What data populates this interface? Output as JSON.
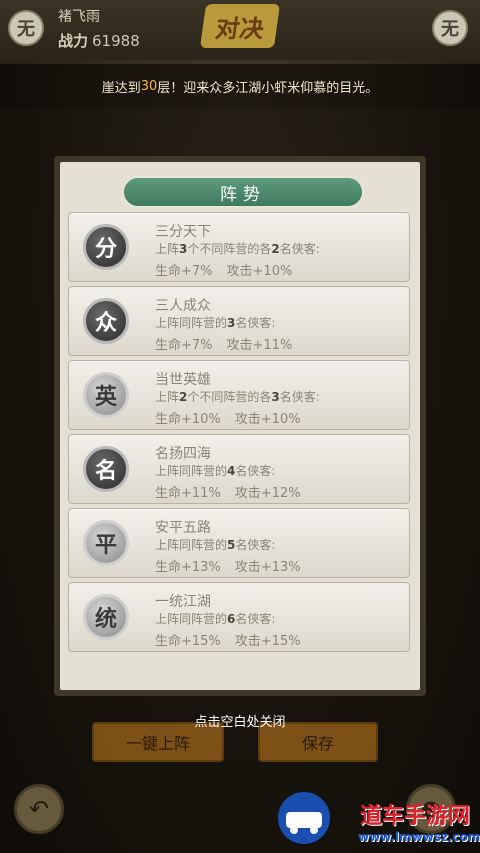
{
  "header": {
    "left_icon_char": "无",
    "right_icon_char": "无",
    "player_name": "褚飞雨",
    "power_label": "战力",
    "power_value": "61988",
    "vs_char": "对决"
  },
  "notice": {
    "prefix": "崖达到",
    "highlight": "30",
    "suffix": "层！迎来众多江湖小虾米仰慕的目光。"
  },
  "dialog": {
    "title": "阵势",
    "formations": [
      {
        "icon": "分",
        "name": "三分天下",
        "cond_pre": "上阵",
        "cond_num1": "3",
        "cond_mid": "个不同阵营的各",
        "cond_num2": "2",
        "cond_post": "名侠客:",
        "hp": "生命+7%",
        "atk": "攻击+10%",
        "style": "dark"
      },
      {
        "icon": "众",
        "name": "三人成众",
        "cond_pre": "上阵同阵营的",
        "cond_num1": "3",
        "cond_mid": "",
        "cond_num2": "",
        "cond_post": "名侠客:",
        "hp": "生命+7%",
        "atk": "攻击+11%",
        "style": "dark"
      },
      {
        "icon": "英",
        "name": "当世英雄",
        "cond_pre": "上阵",
        "cond_num1": "2",
        "cond_mid": "个不同阵营的各",
        "cond_num2": "3",
        "cond_post": "名侠客:",
        "hp": "生命+10%",
        "atk": "攻击+10%",
        "style": "light"
      },
      {
        "icon": "名",
        "name": "名扬四海",
        "cond_pre": "上阵同阵营的",
        "cond_num1": "4",
        "cond_mid": "",
        "cond_num2": "",
        "cond_post": "名侠客:",
        "hp": "生命+11%",
        "atk": "攻击+12%",
        "style": "dark"
      },
      {
        "icon": "平",
        "name": "安平五路",
        "cond_pre": "上阵同阵营的",
        "cond_num1": "5",
        "cond_mid": "",
        "cond_num2": "",
        "cond_post": "名侠客:",
        "hp": "生命+13%",
        "atk": "攻击+13%",
        "style": "light"
      },
      {
        "icon": "统",
        "name": "一统江湖",
        "cond_pre": "上阵同阵营的",
        "cond_num1": "6",
        "cond_mid": "",
        "cond_num2": "",
        "cond_post": "名侠客:",
        "hp": "生命+15%",
        "atk": "攻击+15%",
        "style": "light"
      }
    ],
    "close_hint": "点击空白处关闭"
  },
  "bottom": {
    "auto_deploy_label": "一键上阵",
    "save_label": "保存"
  },
  "watermark": {
    "text": "道车手游网",
    "url": "www.lmwwsz.com"
  },
  "colors": {
    "highlight": "#ffb52e",
    "title_green": "#4f8a6c",
    "button_orange": "#c07a1e"
  }
}
